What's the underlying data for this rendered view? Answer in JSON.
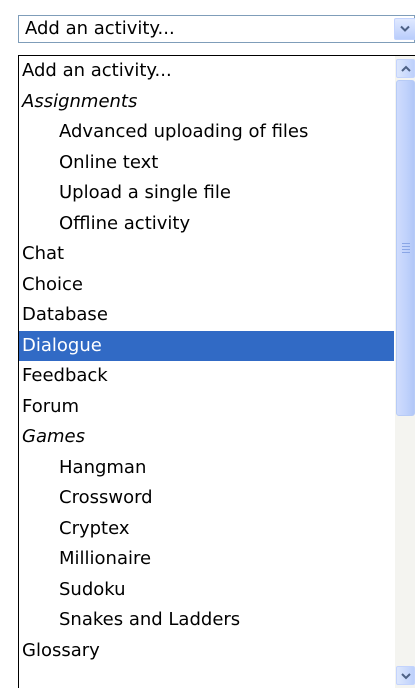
{
  "select": {
    "value": "Add an activity...",
    "icon": "chevron-down-icon"
  },
  "options": [
    {
      "label": "Add an activity...",
      "kind": "option",
      "indent": false,
      "selected": false
    },
    {
      "label": "Assignments",
      "kind": "group",
      "indent": false,
      "selected": false
    },
    {
      "label": "Advanced uploading of files",
      "kind": "option",
      "indent": true,
      "selected": false
    },
    {
      "label": "Online text",
      "kind": "option",
      "indent": true,
      "selected": false
    },
    {
      "label": "Upload a single file",
      "kind": "option",
      "indent": true,
      "selected": false
    },
    {
      "label": "Offline activity",
      "kind": "option",
      "indent": true,
      "selected": false
    },
    {
      "label": "Chat",
      "kind": "option",
      "indent": false,
      "selected": false
    },
    {
      "label": "Choice",
      "kind": "option",
      "indent": false,
      "selected": false
    },
    {
      "label": "Database",
      "kind": "option",
      "indent": false,
      "selected": false
    },
    {
      "label": "Dialogue",
      "kind": "option",
      "indent": false,
      "selected": true
    },
    {
      "label": "Feedback",
      "kind": "option",
      "indent": false,
      "selected": false
    },
    {
      "label": "Forum",
      "kind": "option",
      "indent": false,
      "selected": false
    },
    {
      "label": "Games",
      "kind": "group",
      "indent": false,
      "selected": false
    },
    {
      "label": "Hangman",
      "kind": "option",
      "indent": true,
      "selected": false
    },
    {
      "label": "Crossword",
      "kind": "option",
      "indent": true,
      "selected": false
    },
    {
      "label": "Cryptex",
      "kind": "option",
      "indent": true,
      "selected": false
    },
    {
      "label": "Millionaire",
      "kind": "option",
      "indent": true,
      "selected": false
    },
    {
      "label": "Sudoku",
      "kind": "option",
      "indent": true,
      "selected": false
    },
    {
      "label": "Snakes and Ladders",
      "kind": "option",
      "indent": true,
      "selected": false
    },
    {
      "label": "Glossary",
      "kind": "option",
      "indent": false,
      "selected": false
    }
  ],
  "scrollbar": {
    "up_icon": "chevron-up-icon",
    "down_icon": "chevron-down-icon"
  },
  "colors": {
    "selection": "#316ac5",
    "selection_text": "#ffffff",
    "border": "#7f9db9"
  }
}
